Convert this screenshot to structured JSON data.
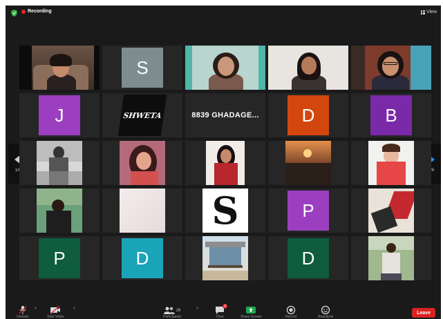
{
  "topbar": {
    "recording_label": "Recording",
    "view_label": "View"
  },
  "pager": {
    "left_page": "1/6",
    "right_page": "1/6"
  },
  "tiles": {
    "t6_letter": "J",
    "t7_label": "SHWETA",
    "t8_name": "8839 GHADAGE...",
    "t9_letter": "D",
    "t10_letter": "B",
    "t2_letter": "S",
    "t18_letter": "S",
    "t19_letter": "P",
    "t21_letter": "P",
    "t22_letter": "D",
    "t24_letter": "D"
  },
  "colors": {
    "avatar_gray": "#7f8c8d",
    "avatar_purple": "#9b3fc0",
    "avatar_purple_dark": "#7a2aa8",
    "avatar_orange": "#d3470f",
    "avatar_teal": "#1aa4b8",
    "avatar_green": "#0f5c3f",
    "active_speaker": "#7ad36a",
    "leave_red": "#d92323"
  },
  "toolbar": {
    "unmute_label": "Unmute",
    "start_video_label": "Start Video",
    "participants_count": "26",
    "participants_label": "Participants",
    "chat_label": "Chat",
    "chat_badge": "4",
    "share_label": "Share Screen",
    "record_label": "Record",
    "reactions_label": "Reactions",
    "leave_label": "Leave"
  },
  "icons": [
    "shield-icon",
    "recording-dot-icon",
    "grid-view-icon",
    "prev-page-icon",
    "next-page-icon",
    "mic-muted-icon",
    "video-off-icon",
    "participants-icon",
    "chat-icon",
    "share-screen-icon",
    "record-icon",
    "reactions-icon"
  ]
}
